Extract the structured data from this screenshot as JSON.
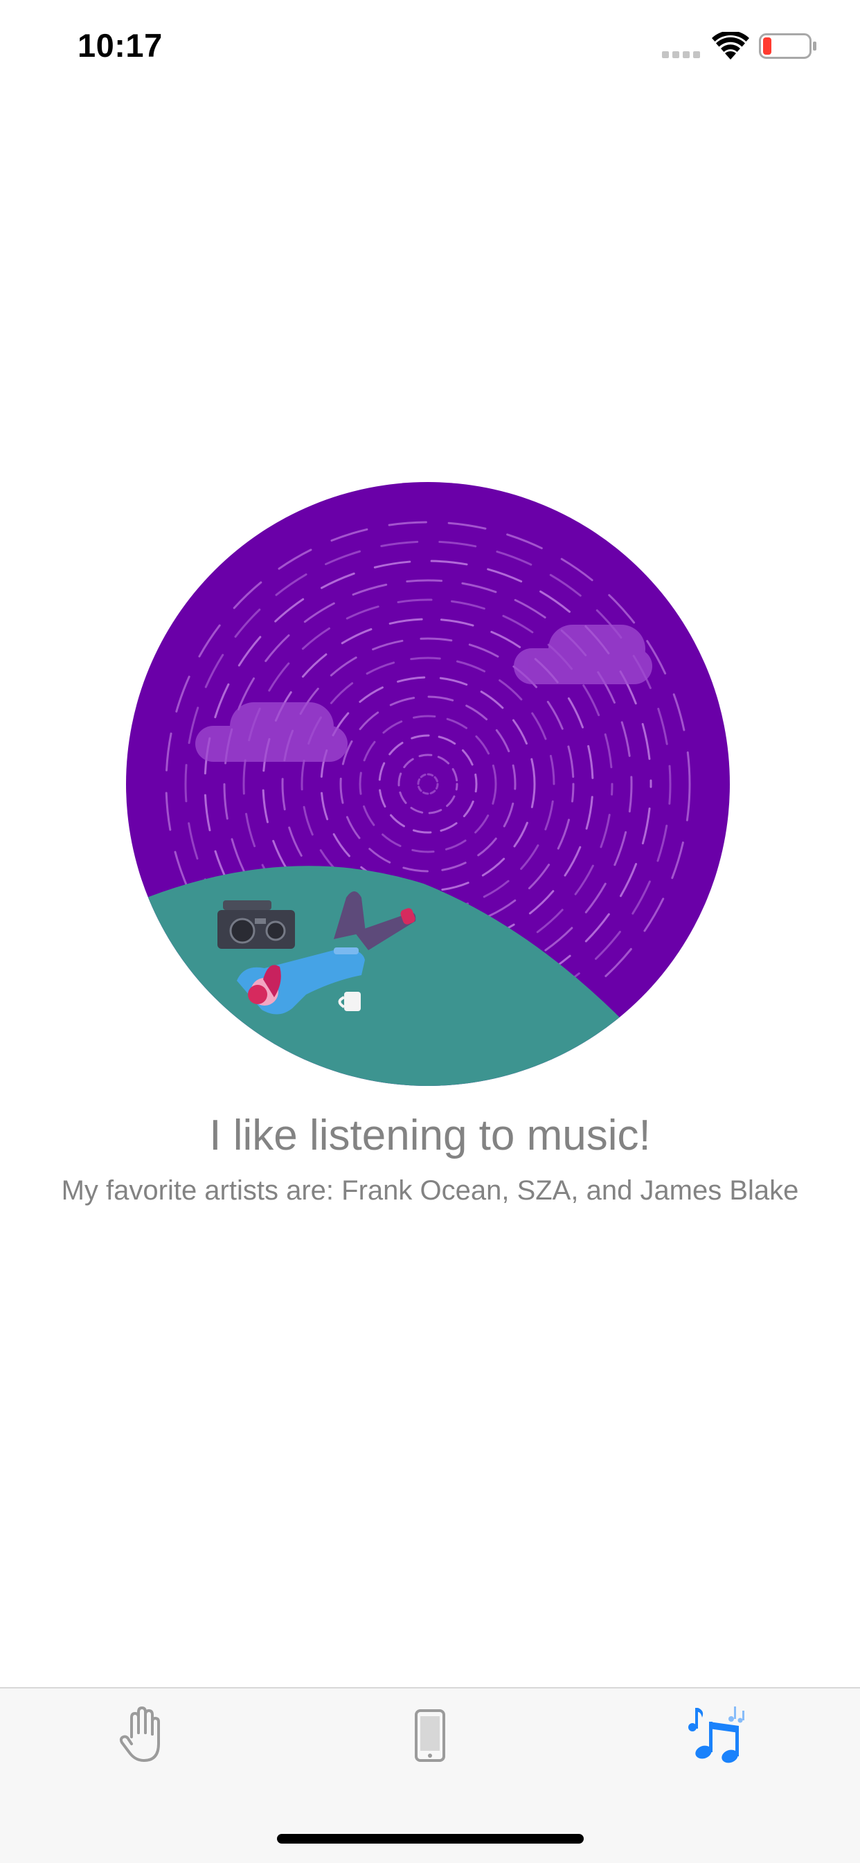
{
  "status_bar": {
    "time": "10:17"
  },
  "content": {
    "title": "I like listening to music!",
    "subtitle": "My favorite artists are: Frank Ocean, SZA, and James Blake"
  },
  "tabs": [
    {
      "icon": "hand-icon",
      "selected": false
    },
    {
      "icon": "phone-icon",
      "selected": false
    },
    {
      "icon": "music-note-icon",
      "selected": true
    }
  ],
  "colors": {
    "accent": "#1a82fb",
    "circle": "#6a00a8",
    "grass": "#3d9490",
    "text": "#838383",
    "tab_inactive": "#9b9b9b"
  }
}
